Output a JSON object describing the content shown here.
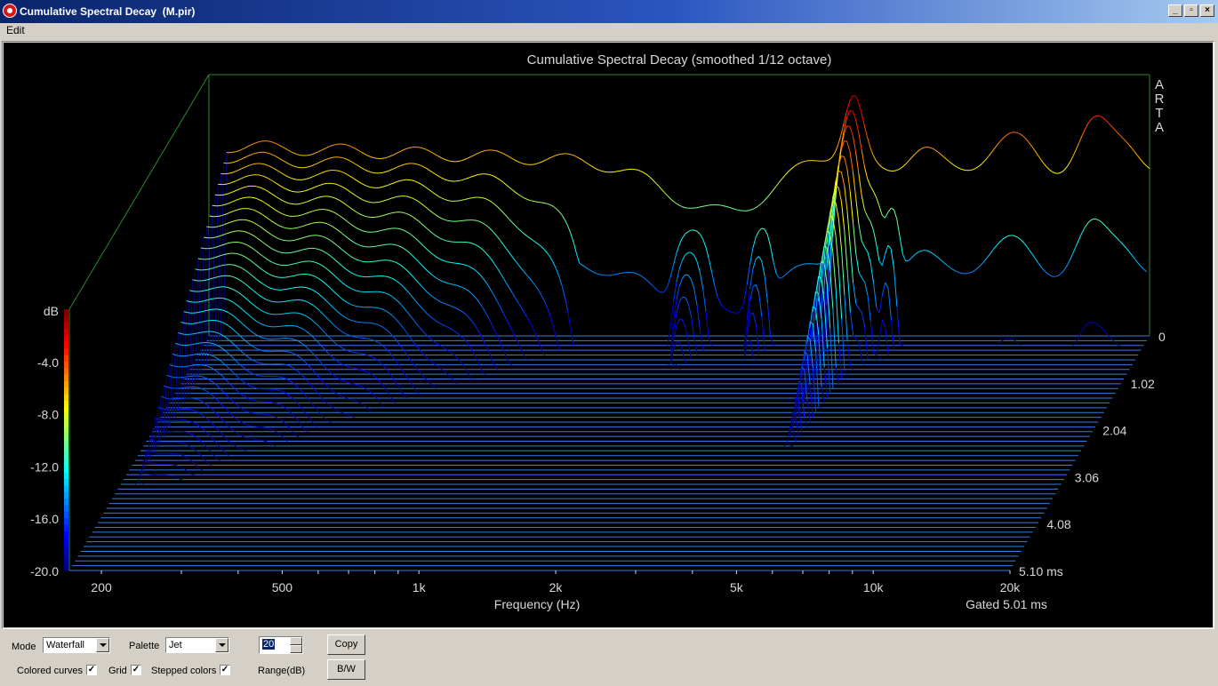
{
  "window": {
    "title": "Cumulative Spectral Decay  (M.pir)"
  },
  "window_controls": {
    "minimize": "_",
    "restore": "▫",
    "close": "×"
  },
  "menu": {
    "edit": "Edit"
  },
  "chart_data": {
    "type": "waterfall",
    "title": "Cumulative Spectral Decay (smoothed 1/12 octave)",
    "watermark": "ARTA",
    "xlabel": "Frequency (Hz)",
    "x_ticks": [
      "200",
      "500",
      "1k",
      "2k",
      "5k",
      "10k",
      "20k"
    ],
    "x_tick_values": [
      200,
      500,
      1000,
      2000,
      5000,
      10000,
      20000
    ],
    "xlim": [
      170,
      20000
    ],
    "x_scale": "log",
    "time_label": "Gated 5.01 ms",
    "time_ticks": [
      "0",
      "1.02",
      "2.04",
      "3.06",
      "4.08",
      "5.10 ms"
    ],
    "time_tick_values": [
      0,
      1.02,
      2.04,
      3.06,
      4.08,
      5.1
    ],
    "ylabel": "dB",
    "y_ticks": [
      "-4.0",
      "-8.0",
      "-12.0",
      "-16.0",
      "-20.0"
    ],
    "ylim": [
      -20,
      0
    ],
    "palette": "Jet",
    "slice_count": 50,
    "colors": {
      "background": "#000000",
      "frame": "#2a8a2a",
      "text": "#d8d8d8",
      "base": "#3a7be0"
    }
  },
  "controls": {
    "mode_label": "Mode",
    "mode_value": "Waterfall",
    "palette_label": "Palette",
    "palette_value": "Jet",
    "range_value": "20",
    "range_label": "Range(dB)",
    "copy_button": "Copy",
    "bw_button": "B/W",
    "colored_curves_label": "Colored curves",
    "colored_curves_checked": true,
    "grid_label": "Grid",
    "grid_checked": true,
    "stepped_colors_label": "Stepped colors",
    "stepped_colors_checked": true,
    "check_mark": "✓"
  }
}
